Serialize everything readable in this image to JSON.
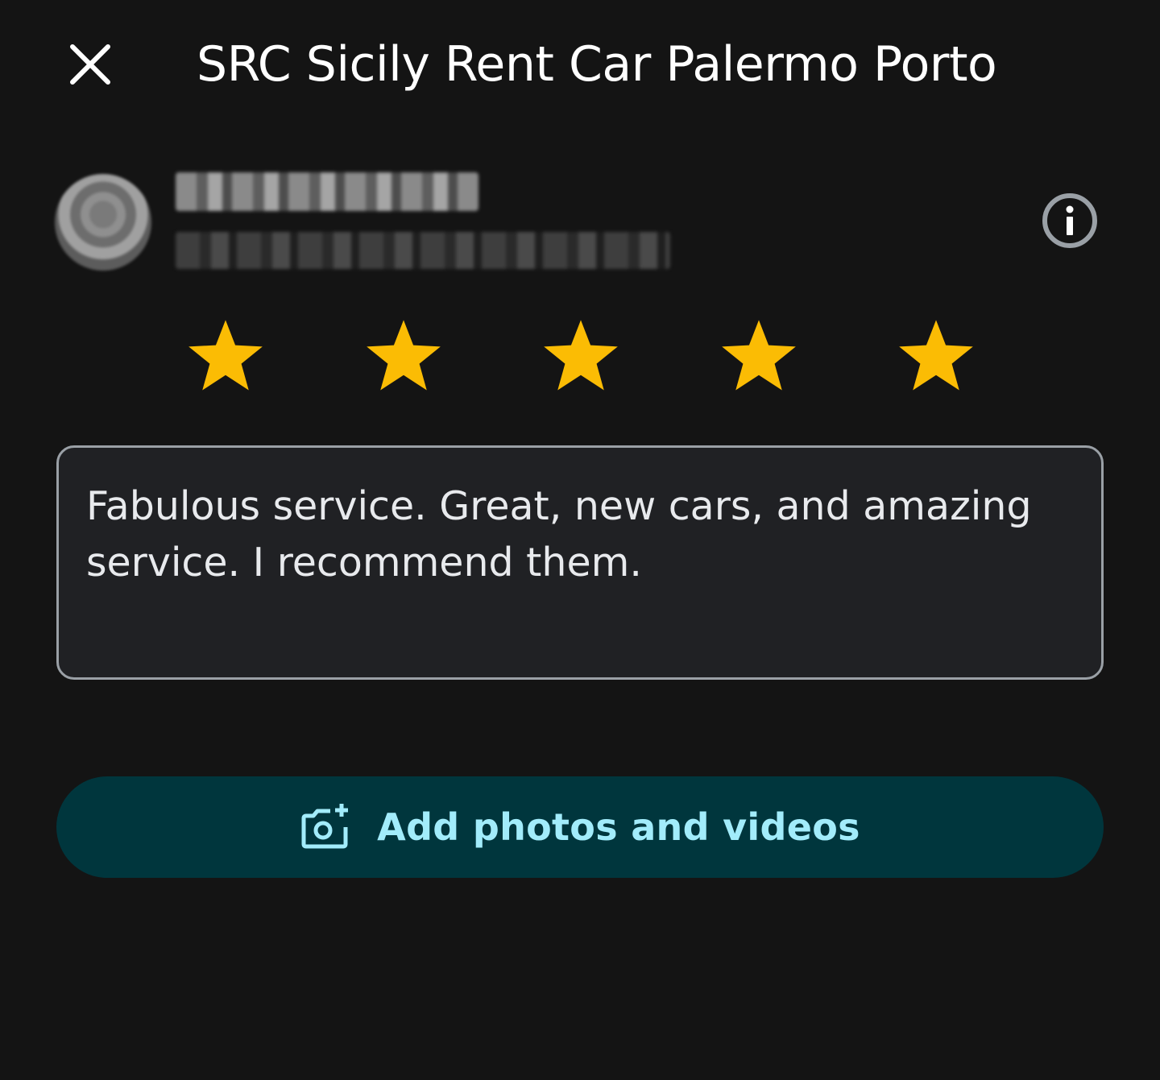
{
  "header": {
    "close_icon": "close-icon",
    "title": "SRC Sicily Rent Car Palermo Porto"
  },
  "user": {
    "avatar_icon": "avatar",
    "name": "",
    "subtitle": "",
    "info_icon": "info-icon"
  },
  "rating": {
    "value": 5,
    "max": 5,
    "star_color": "#fbbc04"
  },
  "review": {
    "text": "Fabulous service. Great, new cars, and amazing service. I recommend them.",
    "border_color": "#9aa0a6"
  },
  "media_button": {
    "icon": "add-photo-icon",
    "label": "Add photos and videos",
    "background": "#00363d",
    "text_color": "#a2ecfb"
  }
}
